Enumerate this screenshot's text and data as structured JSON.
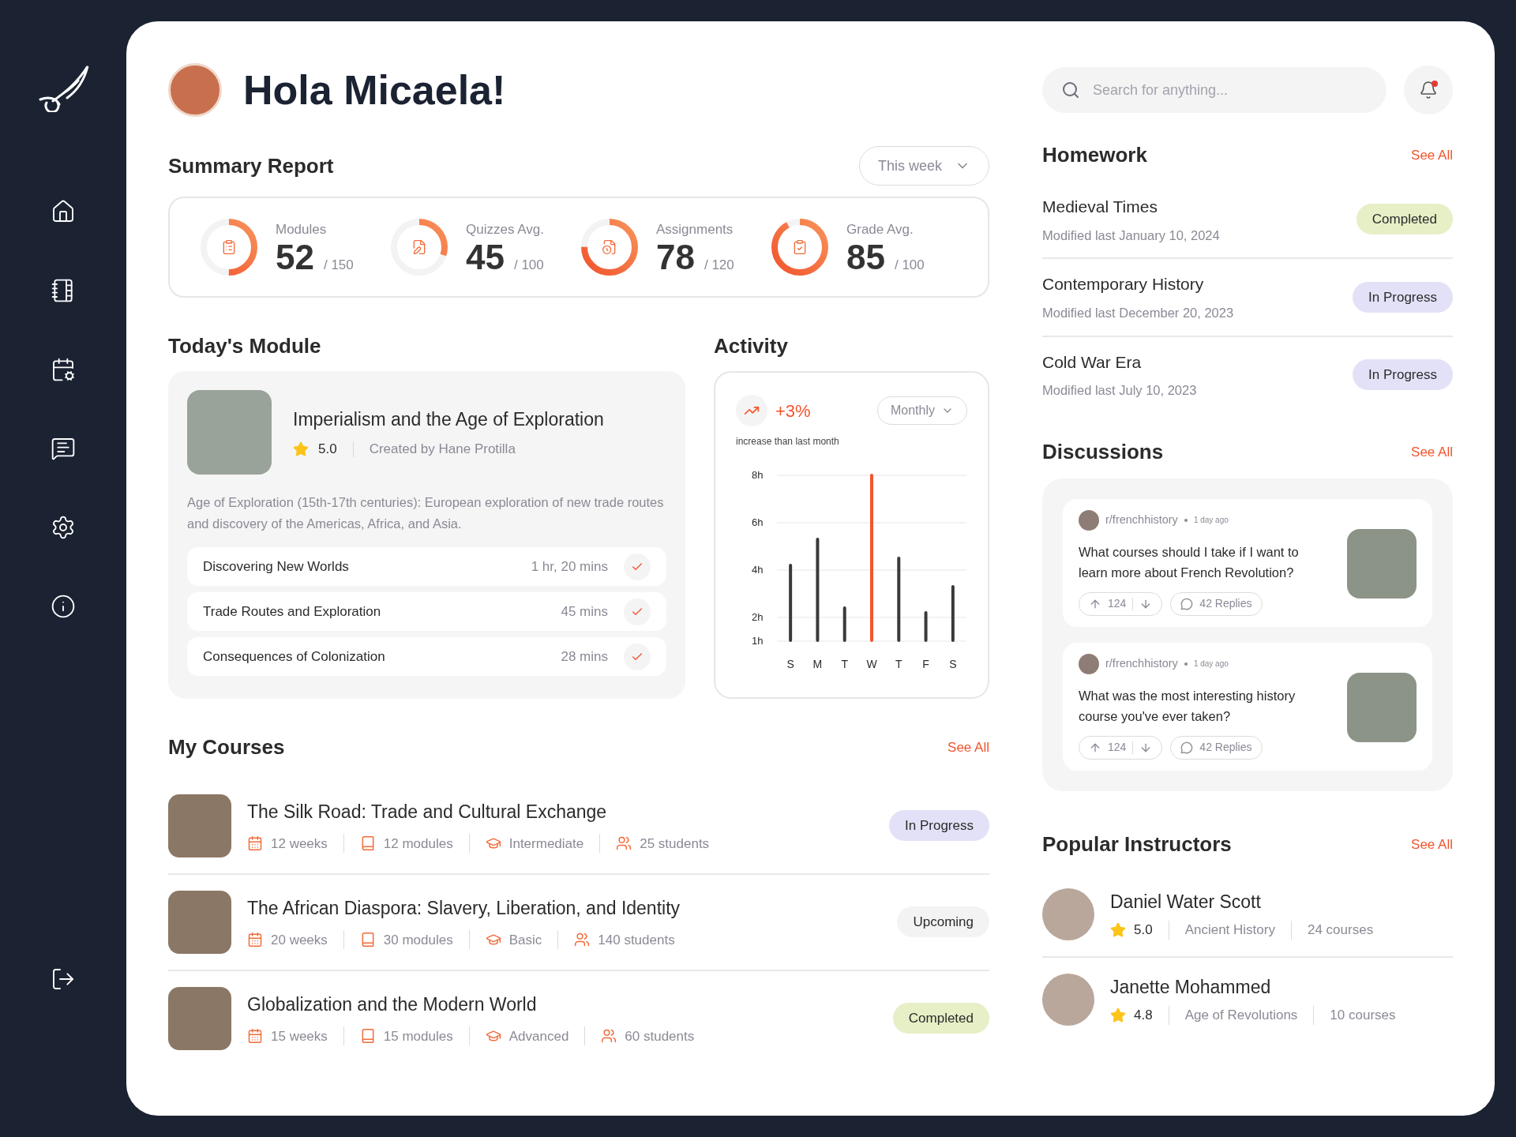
{
  "header": {
    "greeting": "Hola Micaela!"
  },
  "search": {
    "placeholder": "Search for anything..."
  },
  "notifications": {
    "unread": true
  },
  "summary": {
    "title": "Summary Report",
    "period": "This week",
    "stats": [
      {
        "label": "Modules",
        "value": "52",
        "total": "/ 150",
        "level": 0.5
      },
      {
        "label": "Quizzes Avg.",
        "value": "45",
        "total": "/ 100",
        "level": 0.3
      },
      {
        "label": "Assignments",
        "value": "78",
        "total": "/ 120",
        "level": 0.75
      },
      {
        "label": "Grade Avg.",
        "value": "85",
        "total": "/ 100",
        "level": 0.92
      }
    ]
  },
  "todays_module": {
    "title": "Today's Module",
    "name": "Imperialism and the Age of Exploration",
    "rating": "5.0",
    "author": "Created by Hane Protilla",
    "description": "Age of Exploration (15th-17th centuries): European exploration of new trade routes and discovery of the Americas, Africa, and Asia.",
    "lessons": [
      {
        "name": "Discovering New Worlds",
        "duration": "1 hr, 20 mins",
        "done": true
      },
      {
        "name": "Trade Routes and Exploration",
        "duration": "45 mins",
        "done": true
      },
      {
        "name": "Consequences of Colonization",
        "duration": "28 mins",
        "done": true
      }
    ]
  },
  "activity": {
    "title": "Activity",
    "change": "+3%",
    "note": "increase than last month",
    "period": "Monthly",
    "chart_data": {
      "type": "bar",
      "categories": [
        "S",
        "M",
        "T",
        "W",
        "T",
        "F",
        "S"
      ],
      "series": [
        {
          "color": "#3a3a3a",
          "values": [
            4.2,
            5.3,
            2.4,
            null,
            4.5,
            2.2,
            3.3
          ]
        },
        {
          "color": "#f2542d",
          "values": [
            null,
            null,
            null,
            8,
            null,
            null,
            null
          ]
        }
      ],
      "grid": true,
      "ylim": [
        1,
        8
      ],
      "yticks": [
        {
          "value": 1,
          "label": "1h"
        },
        {
          "value": 2,
          "label": "2h"
        },
        {
          "value": 4,
          "label": "4h"
        },
        {
          "value": 6,
          "label": "6h"
        },
        {
          "value": 8,
          "label": "8h"
        }
      ]
    }
  },
  "my_courses": {
    "title": "My Courses",
    "see_all": "See All",
    "courses": [
      {
        "title": "The Silk Road: Trade and Cultural Exchange",
        "duration": "12 weeks",
        "modules": "12 modules",
        "level": "Intermediate",
        "students": "25 students",
        "status": "In Progress",
        "kind": "in_progress"
      },
      {
        "title": "The African Diaspora: Slavery, Liberation, and Identity",
        "duration": "20 weeks",
        "modules": "30 modules",
        "level": "Basic",
        "students": "140 students",
        "status": "Upcoming",
        "kind": "upcoming"
      },
      {
        "title": "Globalization and the Modern World",
        "duration": "15 weeks",
        "modules": "15 modules",
        "level": "Advanced",
        "students": "60 students",
        "status": "Completed",
        "kind": "completed"
      }
    ]
  },
  "homework": {
    "title": "Homework",
    "see_all": "See All",
    "items": [
      {
        "name": "Medieval Times",
        "modified": "Modified last January 10, 2024",
        "status": "Completed",
        "kind": "completed"
      },
      {
        "name": "Contemporary History",
        "modified": "Modified last December 20, 2023",
        "status": "In Progress",
        "kind": "in_progress"
      },
      {
        "name": "Cold War Era",
        "modified": "Modified last July 10, 2023",
        "status": "In Progress",
        "kind": "in_progress"
      }
    ]
  },
  "discussions": {
    "title": "Discussions",
    "see_all": "See All",
    "posts": [
      {
        "community": "r/frenchhistory",
        "time": "1 day ago",
        "question": "What courses should I take if I want to learn more about French Revolution?",
        "votes": "124",
        "replies": "42 Replies"
      },
      {
        "community": "r/frenchhistory",
        "time": "1 day ago",
        "question": "What was the most interesting history course you've ever taken?",
        "votes": "124",
        "replies": "42 Replies"
      }
    ]
  },
  "instructors": {
    "title": "Popular Instructors",
    "see_all": "See All",
    "people": [
      {
        "name": "Daniel Water Scott",
        "rating": "5.0",
        "subject": "Ancient History",
        "courses": "24 courses"
      },
      {
        "name": "Janette Mohammed",
        "rating": "4.8",
        "subject": "Age of Revolutions",
        "courses": "10 courses"
      }
    ]
  }
}
